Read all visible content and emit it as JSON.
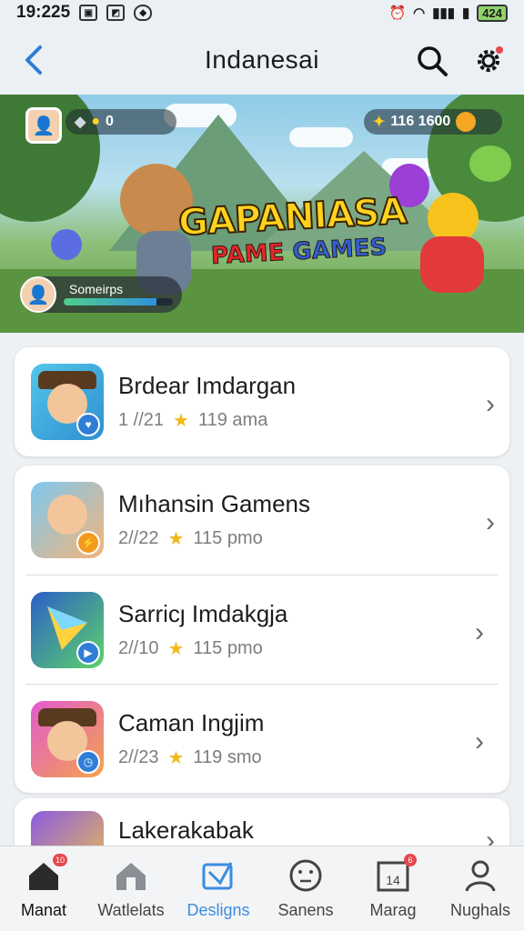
{
  "status": {
    "time": "19:225",
    "battery": "424"
  },
  "header": {
    "title": "Indanesai"
  },
  "banner": {
    "coins_left": "0",
    "coins_right": "116 1600",
    "logo_line1": "GAPANIASA",
    "logo_line2_a": "PAME",
    "logo_line2_b": "GAMES",
    "player_name": "Someirps",
    "player_progress_percent": 85
  },
  "games": [
    {
      "name": "Brdear Imdargan",
      "date": "1 //21",
      "rating": "119 ama"
    },
    {
      "name": "Mıhansin Gamens",
      "date": "2//22",
      "rating": "115 pmo"
    },
    {
      "name": "Sarricȷ Imdakgja",
      "date": "2//10",
      "rating": "115 pmo"
    },
    {
      "name": "Caman Ingjim",
      "date": "2//23",
      "rating": "119 smo"
    },
    {
      "name": "Lakerakabak",
      "date": "",
      "rating": ""
    }
  ],
  "nav": [
    {
      "label": "Manat",
      "icon": "home-icon",
      "badge": "10"
    },
    {
      "label": "Watlelats",
      "icon": "store-icon",
      "badge": ""
    },
    {
      "label": "Desligns",
      "icon": "designs-icon",
      "badge": ""
    },
    {
      "label": "Sanens",
      "icon": "face-icon",
      "badge": ""
    },
    {
      "label": "Marag",
      "icon": "calendar-icon",
      "badge": "6"
    },
    {
      "label": "Nughals",
      "icon": "profile-icon",
      "badge": ""
    }
  ],
  "calendar_day": "14",
  "colors": {
    "accent": "#3a8de0",
    "star": "#f1b81b",
    "badge": "#e5484d"
  }
}
